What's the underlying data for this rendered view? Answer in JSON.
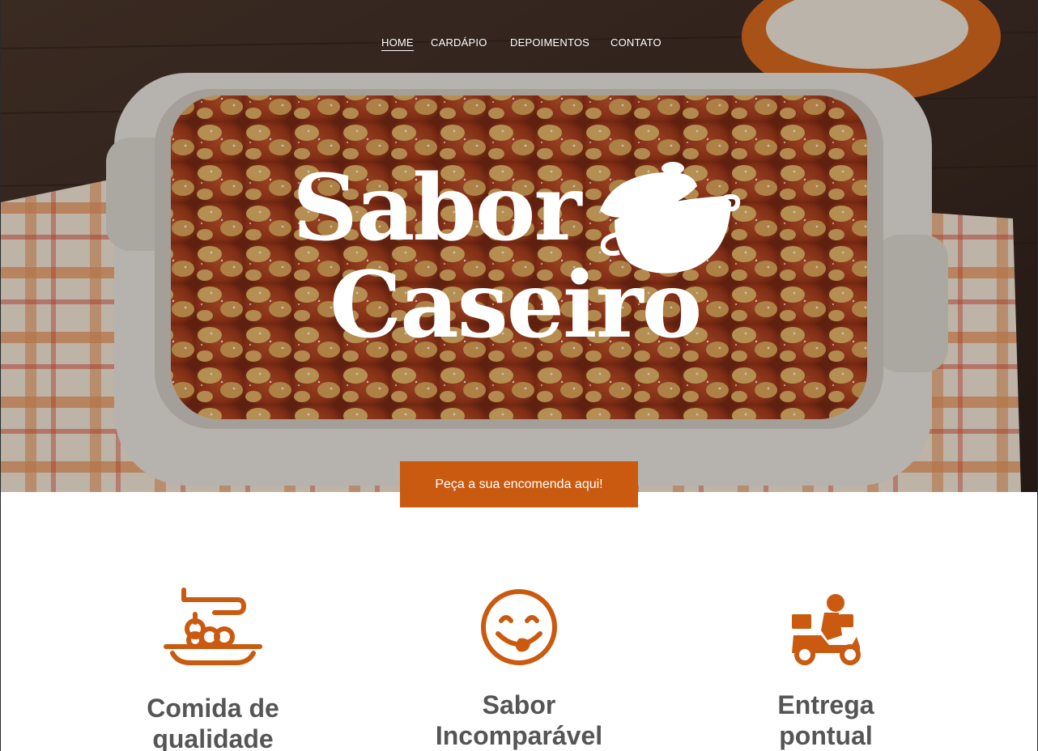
{
  "nav": {
    "items": [
      {
        "label": "HOME",
        "active": true
      },
      {
        "label": "CARDÁPIO",
        "active": false
      },
      {
        "label": "DEPOIMENTOS",
        "active": false
      },
      {
        "label": "CONTATO",
        "active": false
      }
    ]
  },
  "hero": {
    "logo_line1": "Sabor",
    "logo_line2": "Caseiro",
    "logo_icon": "cooking-pot-icon",
    "cta_label": "Peça a sua encomenda aqui!"
  },
  "features": [
    {
      "icon": "food-plate-icon",
      "title_line1": "Comida de",
      "title_line2": "qualidade"
    },
    {
      "icon": "smiling-face-icon",
      "title_line1": "Sabor",
      "title_line2": "Incomparável"
    },
    {
      "icon": "delivery-scooter-icon",
      "title_line1": "Entrega",
      "title_line2": "pontual"
    }
  ],
  "colors": {
    "accent": "#c95a0f",
    "feature_title": "#555555",
    "nav_text": "#ffffff"
  }
}
